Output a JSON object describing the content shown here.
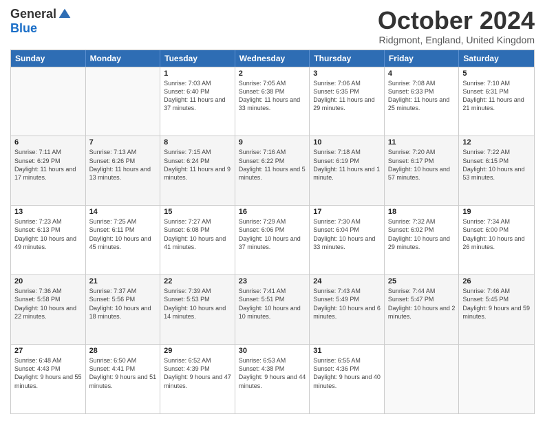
{
  "logo": {
    "general": "General",
    "blue": "Blue"
  },
  "title": "October 2024",
  "location": "Ridgmont, England, United Kingdom",
  "days": [
    "Sunday",
    "Monday",
    "Tuesday",
    "Wednesday",
    "Thursday",
    "Friday",
    "Saturday"
  ],
  "weeks": [
    [
      {
        "day": "",
        "info": ""
      },
      {
        "day": "",
        "info": ""
      },
      {
        "day": "1",
        "info": "Sunrise: 7:03 AM\nSunset: 6:40 PM\nDaylight: 11 hours and 37 minutes."
      },
      {
        "day": "2",
        "info": "Sunrise: 7:05 AM\nSunset: 6:38 PM\nDaylight: 11 hours and 33 minutes."
      },
      {
        "day": "3",
        "info": "Sunrise: 7:06 AM\nSunset: 6:35 PM\nDaylight: 11 hours and 29 minutes."
      },
      {
        "day": "4",
        "info": "Sunrise: 7:08 AM\nSunset: 6:33 PM\nDaylight: 11 hours and 25 minutes."
      },
      {
        "day": "5",
        "info": "Sunrise: 7:10 AM\nSunset: 6:31 PM\nDaylight: 11 hours and 21 minutes."
      }
    ],
    [
      {
        "day": "6",
        "info": "Sunrise: 7:11 AM\nSunset: 6:29 PM\nDaylight: 11 hours and 17 minutes."
      },
      {
        "day": "7",
        "info": "Sunrise: 7:13 AM\nSunset: 6:26 PM\nDaylight: 11 hours and 13 minutes."
      },
      {
        "day": "8",
        "info": "Sunrise: 7:15 AM\nSunset: 6:24 PM\nDaylight: 11 hours and 9 minutes."
      },
      {
        "day": "9",
        "info": "Sunrise: 7:16 AM\nSunset: 6:22 PM\nDaylight: 11 hours and 5 minutes."
      },
      {
        "day": "10",
        "info": "Sunrise: 7:18 AM\nSunset: 6:19 PM\nDaylight: 11 hours and 1 minute."
      },
      {
        "day": "11",
        "info": "Sunrise: 7:20 AM\nSunset: 6:17 PM\nDaylight: 10 hours and 57 minutes."
      },
      {
        "day": "12",
        "info": "Sunrise: 7:22 AM\nSunset: 6:15 PM\nDaylight: 10 hours and 53 minutes."
      }
    ],
    [
      {
        "day": "13",
        "info": "Sunrise: 7:23 AM\nSunset: 6:13 PM\nDaylight: 10 hours and 49 minutes."
      },
      {
        "day": "14",
        "info": "Sunrise: 7:25 AM\nSunset: 6:11 PM\nDaylight: 10 hours and 45 minutes."
      },
      {
        "day": "15",
        "info": "Sunrise: 7:27 AM\nSunset: 6:08 PM\nDaylight: 10 hours and 41 minutes."
      },
      {
        "day": "16",
        "info": "Sunrise: 7:29 AM\nSunset: 6:06 PM\nDaylight: 10 hours and 37 minutes."
      },
      {
        "day": "17",
        "info": "Sunrise: 7:30 AM\nSunset: 6:04 PM\nDaylight: 10 hours and 33 minutes."
      },
      {
        "day": "18",
        "info": "Sunrise: 7:32 AM\nSunset: 6:02 PM\nDaylight: 10 hours and 29 minutes."
      },
      {
        "day": "19",
        "info": "Sunrise: 7:34 AM\nSunset: 6:00 PM\nDaylight: 10 hours and 26 minutes."
      }
    ],
    [
      {
        "day": "20",
        "info": "Sunrise: 7:36 AM\nSunset: 5:58 PM\nDaylight: 10 hours and 22 minutes."
      },
      {
        "day": "21",
        "info": "Sunrise: 7:37 AM\nSunset: 5:56 PM\nDaylight: 10 hours and 18 minutes."
      },
      {
        "day": "22",
        "info": "Sunrise: 7:39 AM\nSunset: 5:53 PM\nDaylight: 10 hours and 14 minutes."
      },
      {
        "day": "23",
        "info": "Sunrise: 7:41 AM\nSunset: 5:51 PM\nDaylight: 10 hours and 10 minutes."
      },
      {
        "day": "24",
        "info": "Sunrise: 7:43 AM\nSunset: 5:49 PM\nDaylight: 10 hours and 6 minutes."
      },
      {
        "day": "25",
        "info": "Sunrise: 7:44 AM\nSunset: 5:47 PM\nDaylight: 10 hours and 2 minutes."
      },
      {
        "day": "26",
        "info": "Sunrise: 7:46 AM\nSunset: 5:45 PM\nDaylight: 9 hours and 59 minutes."
      }
    ],
    [
      {
        "day": "27",
        "info": "Sunrise: 6:48 AM\nSunset: 4:43 PM\nDaylight: 9 hours and 55 minutes."
      },
      {
        "day": "28",
        "info": "Sunrise: 6:50 AM\nSunset: 4:41 PM\nDaylight: 9 hours and 51 minutes."
      },
      {
        "day": "29",
        "info": "Sunrise: 6:52 AM\nSunset: 4:39 PM\nDaylight: 9 hours and 47 minutes."
      },
      {
        "day": "30",
        "info": "Sunrise: 6:53 AM\nSunset: 4:38 PM\nDaylight: 9 hours and 44 minutes."
      },
      {
        "day": "31",
        "info": "Sunrise: 6:55 AM\nSunset: 4:36 PM\nDaylight: 9 hours and 40 minutes."
      },
      {
        "day": "",
        "info": ""
      },
      {
        "day": "",
        "info": ""
      }
    ]
  ]
}
